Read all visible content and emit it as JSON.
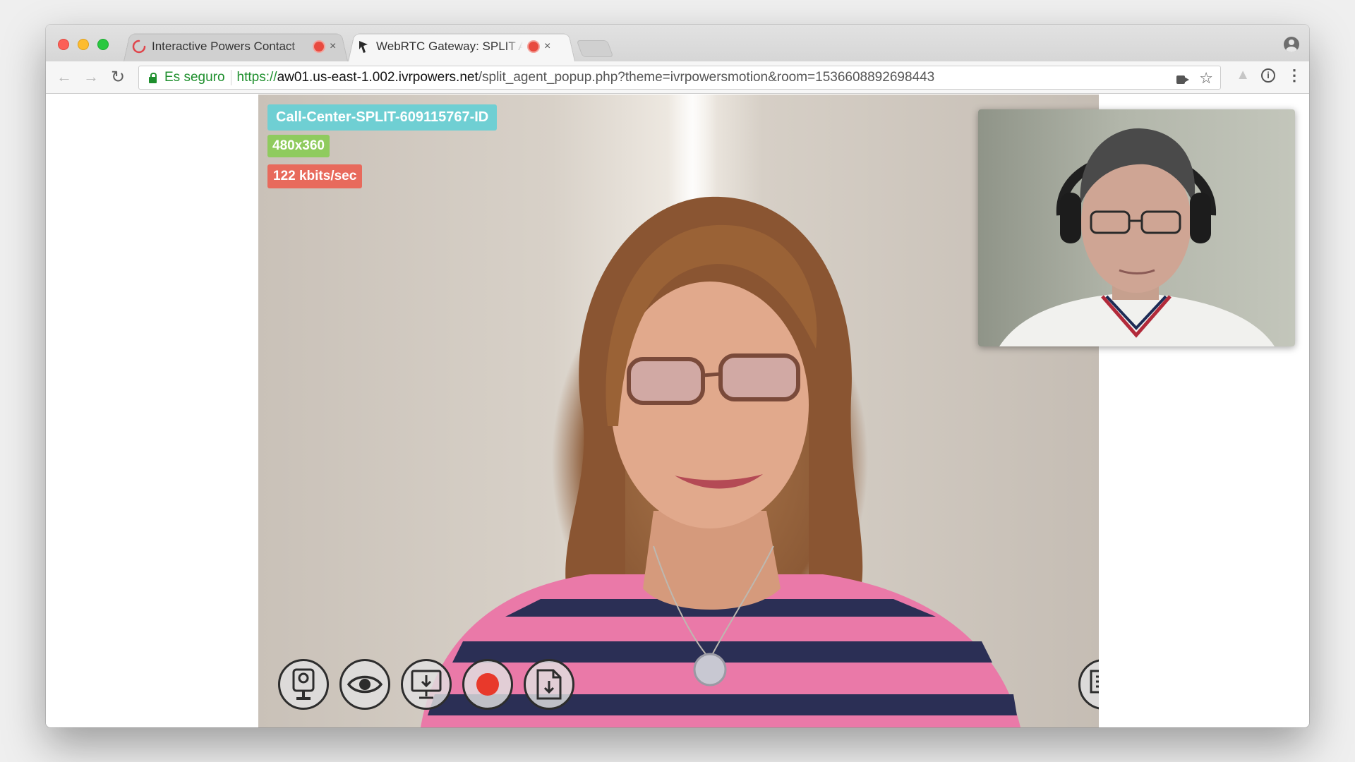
{
  "browser": {
    "tabs": [
      {
        "title": "Interactive Powers Contact",
        "active": false,
        "recording": true
      },
      {
        "title": "WebRTC Gateway: SPLIT Agent",
        "active": true,
        "recording": true
      }
    ],
    "tab_close_glyph": "×",
    "address_bar": {
      "secure_label": "Es seguro",
      "url_scheme": "https://",
      "url_host": "aw01.us-east-1.002.ivrpowers.net",
      "url_path": "/split_agent_popup.php?theme=ivrpowersmotion&room=1536608892698443"
    },
    "icons": [
      "back-icon",
      "forward-icon",
      "reload-icon",
      "camera-icon",
      "star-icon",
      "drive-icon",
      "info-icon",
      "menu-icon",
      "profile-icon"
    ]
  },
  "call": {
    "room_label": "Call-Center-SPLIT-609115767-ID",
    "resolution": "480x360",
    "bitrate": "122 kbits/sec",
    "controls": [
      "webcam-icon",
      "eye-icon",
      "screen-share-icon",
      "record-icon",
      "file-download-icon"
    ],
    "chat_icon": "chat-icon",
    "colors": {
      "room_badge": "#6fcfd3",
      "resolution_badge": "#8fcb5e",
      "bitrate_badge": "#e86a5c",
      "record": "#e8392b"
    }
  }
}
